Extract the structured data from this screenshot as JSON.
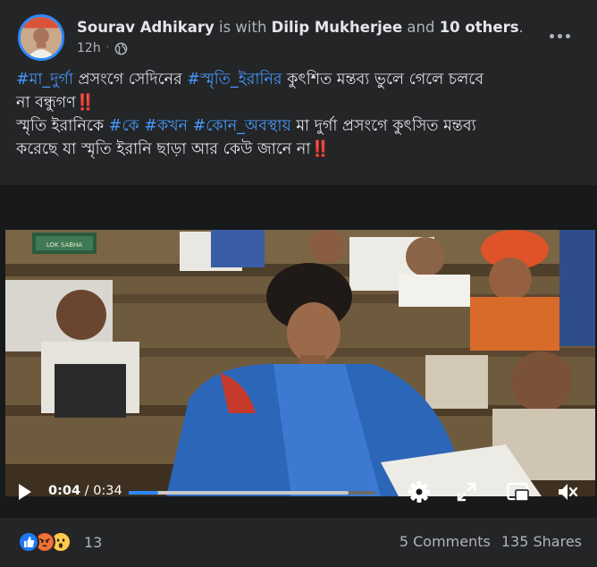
{
  "post": {
    "author": "Sourav Adhikary",
    "with_text": "is with",
    "tagged_person": "Dilip Mukherjee",
    "and_text": "and",
    "others": "10 others",
    "period": ".",
    "timestamp": "12h",
    "audience_icon": "globe-icon",
    "more_icon": "more-options-icon",
    "lines": [
      {
        "t1": "#মা_দুর্গা",
        "t2": " প্রসংগে সেদিনের ",
        "t3": "#স্মৃতি_ইরানির",
        "t4": " কুৎশিত মন্তব্য ভুলে গেলে চলবে"
      },
      {
        "t1": "না বন্ধুগণ",
        "t2": "‼️"
      },
      {
        "t1": "স্মৃতি ইরানিকে ",
        "t2": "#কে #কখন #কোন_অবস্থায়",
        "t3": " মা দুর্গা প্রসংগে কুৎসিত মন্তব্য"
      },
      {
        "t1": "করেছে যা স্মৃতি ইরানি ছাড়া আর কেউ জানে না",
        "t2": "‼️"
      }
    ]
  },
  "video": {
    "banner": "LOK SABHA",
    "current_time": "0:04",
    "separator": " / ",
    "duration": "0:34",
    "progress_played": 0.12,
    "progress_buffered": 0.89,
    "icons": [
      "play-icon",
      "settings-gear-icon",
      "fullscreen-icon",
      "miniplayer-icon",
      "mute-icon"
    ]
  },
  "footer": {
    "reaction_icons": [
      "like-icon",
      "angry-icon",
      "wow-icon"
    ],
    "reaction_count": "13",
    "comments": "5 Comments",
    "shares": "135 Shares"
  },
  "colors": {
    "background": "#242526",
    "link": "#4599ff",
    "accent": "#2d88ff",
    "text": "#e4e6eb",
    "muted": "#b0b3b8"
  }
}
